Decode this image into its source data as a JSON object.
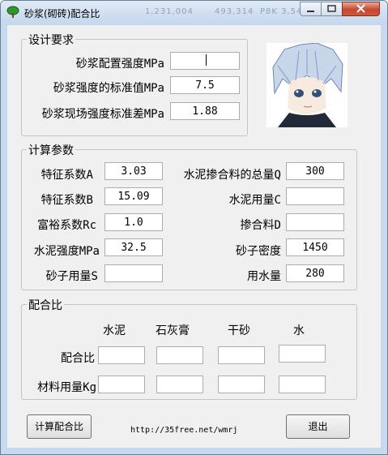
{
  "window": {
    "title": "砂浆(砌砖)配合比",
    "background_titles": [
      "1,231,004",
      "493,314",
      "P8K 3,54"
    ]
  },
  "design": {
    "group_title": "设计要求",
    "fields": [
      {
        "label": "砂浆配置强度MPa",
        "value": ""
      },
      {
        "label": "砂浆强度的标准值MPa",
        "value": "7.5"
      },
      {
        "label": "砂浆现场强度标准差MPa",
        "value": "1.88"
      }
    ]
  },
  "calc": {
    "group_title": "计算参数",
    "left": [
      {
        "label": "特征系数A",
        "value": "3.03"
      },
      {
        "label": "特征系数B",
        "value": "15.09"
      },
      {
        "label": "富裕系数Rc",
        "value": "1.0"
      },
      {
        "label": "水泥强度MPa",
        "value": "32.5"
      },
      {
        "label": "砂子用量S",
        "value": ""
      }
    ],
    "right": [
      {
        "label": "水泥掺合料的总量Q",
        "value": "300"
      },
      {
        "label": "水泥用量C",
        "value": ""
      },
      {
        "label": "掺合料D",
        "value": ""
      },
      {
        "label": "砂子密度",
        "value": "1450"
      },
      {
        "label": "用水量",
        "value": "280"
      }
    ]
  },
  "mix": {
    "group_title": "配合比",
    "columns": [
      "水泥",
      "石灰膏",
      "干砂",
      "水"
    ],
    "rows": [
      {
        "label": "配合比",
        "values": [
          "",
          "",
          "",
          ""
        ]
      },
      {
        "label": "材料用量Kg",
        "values": [
          "",
          "",
          "",
          ""
        ]
      }
    ]
  },
  "footer": {
    "calc_button": "计算配合比",
    "url": "http://35free.net/wmrj",
    "exit_button": "退出"
  },
  "colors": {
    "titlebar": "#c6d9ee",
    "close_button": "#c9462e",
    "client_bg": "#f0f0f0"
  }
}
